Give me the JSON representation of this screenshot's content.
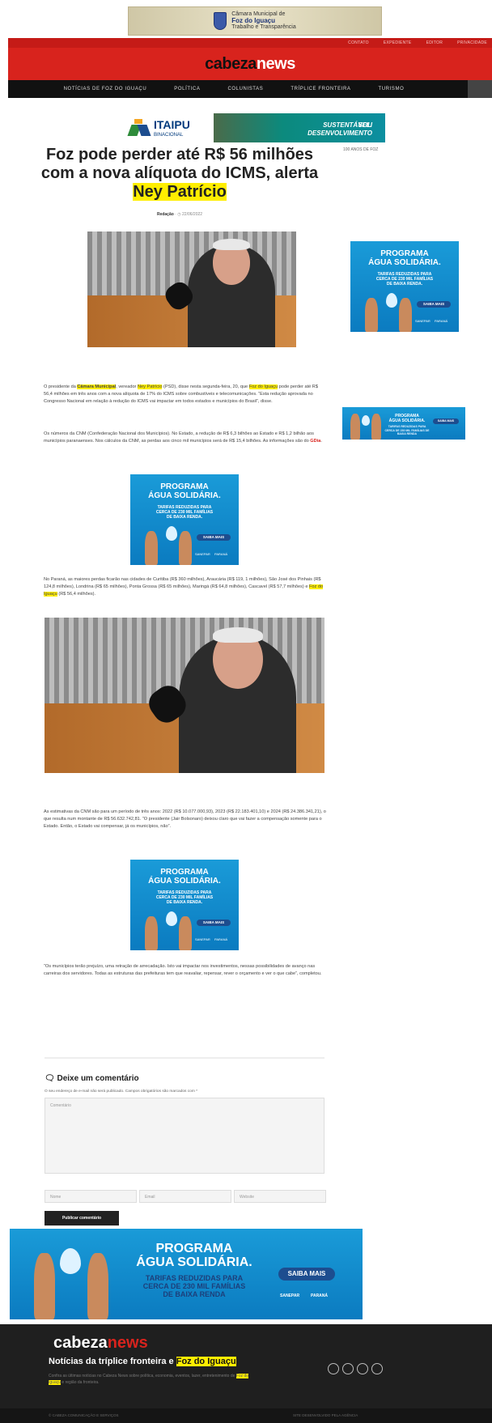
{
  "top_banner": {
    "line1": "Câmara Municipal de",
    "line2": "Foz do Iguaçu",
    "line3": "Trabalho e Transparência"
  },
  "header": {
    "util_links": [
      "CONTATO",
      "EXPEDIENTE",
      "EDITOR",
      "PRIVACIDADE"
    ],
    "logo_part1": "cabeza",
    "logo_part2": "news",
    "nav": [
      "NOTÍCIAS DE FOZ DO IGUAÇU",
      "POLÍTICA",
      "COLUNISTAS",
      "TRÍPLICE FRONTEIRA",
      "TURISMO"
    ]
  },
  "itaipu_ad": {
    "brand": "ITAIPU",
    "brand_sub": "BINACIONAL",
    "slogan1": "SOU DESENVOLVIMENTO",
    "slogan2": "SUSTENTÁVEL."
  },
  "breadcrumb": "100 ANOS DE FOZ",
  "article": {
    "title_part1": "Foz pode perder até R$ 56 milhões com a nova alíquota do ICMS, alerta ",
    "title_highlight": "Ney Patrício",
    "author": "Redação",
    "date": "22/06/2022",
    "p1": [
      {
        "t": "O presidente da ",
        "s": ""
      },
      {
        "t": "Câmara Municipal",
        "s": "hlb"
      },
      {
        "t": ", vereador ",
        "s": ""
      },
      {
        "t": "Ney Patrício",
        "s": "hl"
      },
      {
        "t": " (PSD), disse nesta segunda-feira, 20, que ",
        "s": ""
      },
      {
        "t": "Foz do Iguaçu",
        "s": "hl"
      },
      {
        "t": " pode perder até R$ 56,4 milhões em três anos com a nova alíquota de 17% do ICMS sobre combustíveis e telecomunicações. “Esta redução aprovada no Congresso Nacional em relação à redução do ICMS vai impactar em todos estados e municípios do Brasil”, disse.",
        "s": ""
      }
    ],
    "p2": [
      {
        "t": "Os números da CNM (Confederação Nacional dos Municípios). No Estado, a redução de R$ 6,3 bilhões ao Estado e R$ 1,2 bilhão aos municípios paranaenses. Nos cálculos da CNM, as perdas aos cinco mil municípios será de R$ 15,4 bilhões. As informações são do ",
        "s": ""
      },
      {
        "t": "GDia",
        "s": "red"
      },
      {
        "t": ".",
        "s": ""
      }
    ],
    "p3": [
      {
        "t": "No Paraná, as maiores perdas ficarão nas cidades de Curitiba (R$ 360 milhões), Araucária (R$ 119, 1 milhões), São José dos Pinhais (R$ 124,8 milhões), Londrina (R$ 65 milhões), Ponta Grossa (R$ 65 milhões), Maringá (R$ 64,8 milhões), Cascavel (R$ 57,7 milhões) e ",
        "s": ""
      },
      {
        "t": "Foz do Iguaçu",
        "s": "hl"
      },
      {
        "t": " (R$ 56,4 milhões).",
        "s": ""
      }
    ],
    "p4": "As estimativas da CNM são para um período de três anos: 2022 (R$ 10.077.000,93), 2023 (R$ 22.183.401,10) e 2024 (R$ 24.386.341,21), o que resulta num montante de R$ 56.632.742,81. “O presidente (Jair Bolsonaro) deixou claro que vai fazer a compensação somente para o Estado. Então, o Estado vai compensar, já os municípios, não”.",
    "p5": "“Os municípios terão prejuízo, uma retração de arrecadação. Isto vai impactar nos investimentos, nessas possibilidades de avanço nas carreiras dos servidores. Todas as estruturas das prefeituras tem que reavaliar, repensar, rever o orçamento e ver o que cabe”, completou."
  },
  "agua_ad": {
    "line1": "PROGRAMA",
    "line2": "ÁGUA SOLIDÁRIA.",
    "sub1": "TARIFAS REDUZIDAS",
    "sub2": "PARA CERCA DE",
    "sub3": "230 MIL FAMÍLIAS",
    "sub4": "DE BAIXA RENDA.",
    "sub_wide1": "TARIFAS REDUZIDAS PARA",
    "sub_wide2": "CERCA DE 230 MIL FAMÍLIAS",
    "sub_wide3": "DE BAIXA RENDA",
    "cta": "SAIBA MAIS",
    "brand1": "SANEPAR",
    "brand2": "PARANÁ"
  },
  "comments": {
    "title": "Deixe um comentário",
    "note": "O seu endereço de e-mail não será publicado. Campos obrigatórios são marcados com *",
    "textarea_placeholder": "Comentário",
    "name_placeholder": "Nome",
    "email_placeholder": "Email",
    "site_placeholder": "Website",
    "submit": "Publicar comentário"
  },
  "footer": {
    "logo_part1": "cabeza",
    "logo_part2": "news",
    "title_part1": "Notícias da tríplice fronteira e ",
    "title_highlight": "Foz do Iguaçu",
    "desc_part1": "Confira as últimas notícias no Cabeza News sobre política, economia, eventos, lazer, entretenimento de ",
    "desc_highlight": "Foz do Iguaçu",
    "desc_part2": " e região da fronteira.",
    "copyright": "© CABEZA COMUNICAÇÃO E SERVIÇOS",
    "credit": "SITE DESENVOLVIDO PELA AGÊNCIA"
  },
  "colors": {
    "brand_red": "#d8231d",
    "nav_black": "#111111",
    "highlight": "#ffee00",
    "ad_blue": "#1a9bd8"
  }
}
